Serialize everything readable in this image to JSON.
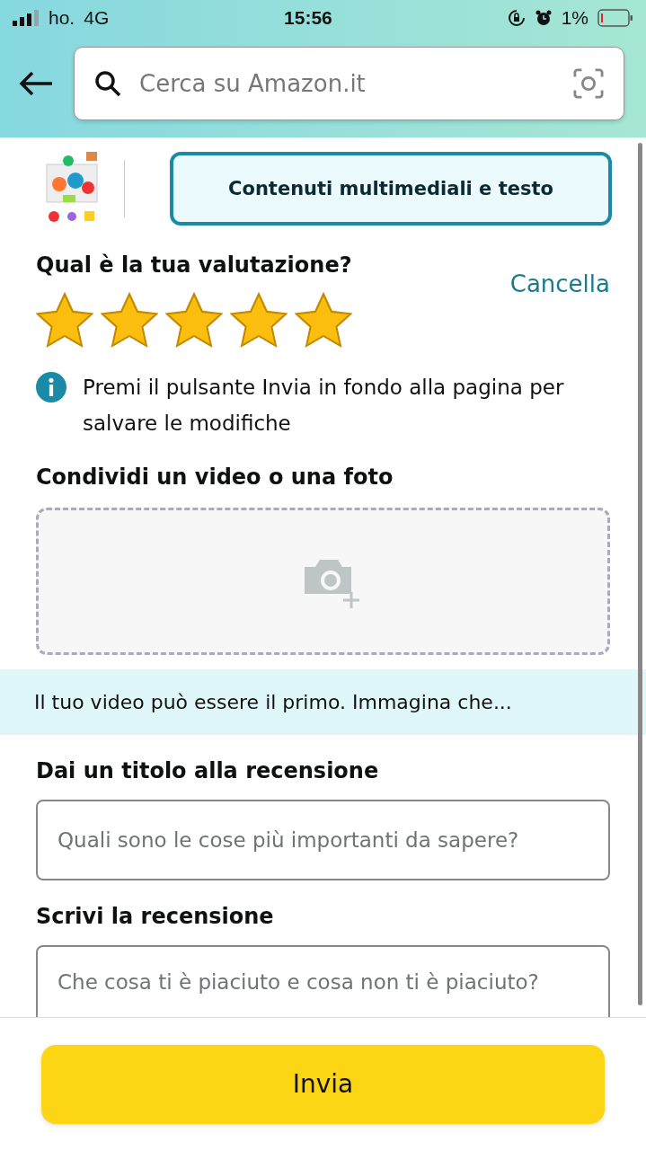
{
  "status_bar": {
    "carrier": "ho.",
    "network": "4G",
    "time": "15:56",
    "battery_percent": "1%"
  },
  "search": {
    "placeholder": "Cerca su Amazon.it"
  },
  "tabs": [
    {
      "label": "Contenuti multimediali e testo",
      "selected": true
    }
  ],
  "rating": {
    "heading": "Qual è la tua valutazione?",
    "clear": "Cancella",
    "stars": 5
  },
  "info": "Premi il pulsante Invia in fondo alla pagina per salvare le modifiche",
  "media": {
    "heading": "Condividi un video o una foto"
  },
  "banner": "Il tuo video può essere il primo. Immagina che...",
  "title_field": {
    "label": "Dai un titolo alla recensione",
    "placeholder": "Quali sono le cose più importanti da sapere?"
  },
  "review_field": {
    "label": "Scrivi la recensione",
    "placeholder": "Che cosa ti è piaciuto e cosa non ti è piaciuto?"
  },
  "submit": "Invia"
}
